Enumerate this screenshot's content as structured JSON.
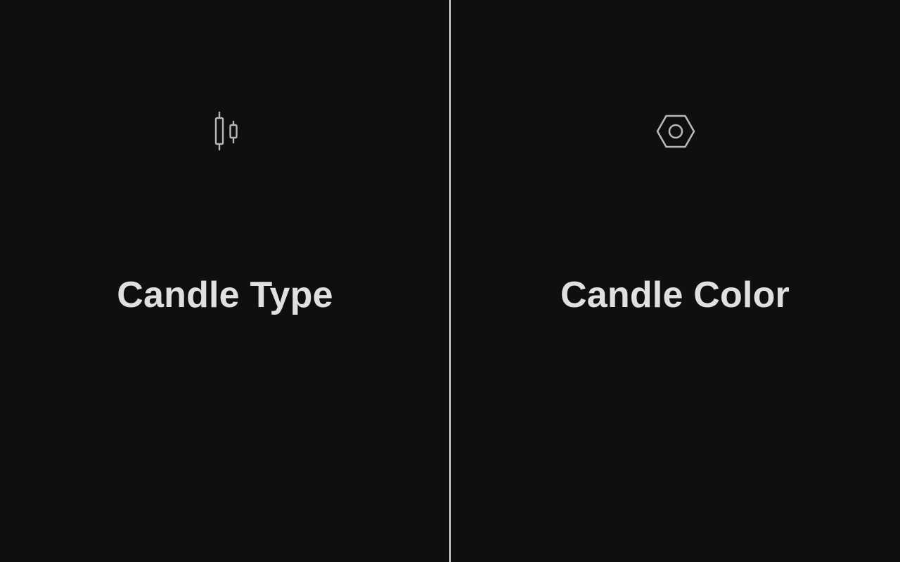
{
  "panels": [
    {
      "label": "Candle Type",
      "icon": "candlestick-icon"
    },
    {
      "label": "Candle Color",
      "icon": "hexagon-nut-icon"
    }
  ],
  "colors": {
    "background": "#0f0f0f",
    "text": "#e0e0e0",
    "icon_stroke": "#b8b8b8",
    "divider": "#e6e6e6"
  }
}
